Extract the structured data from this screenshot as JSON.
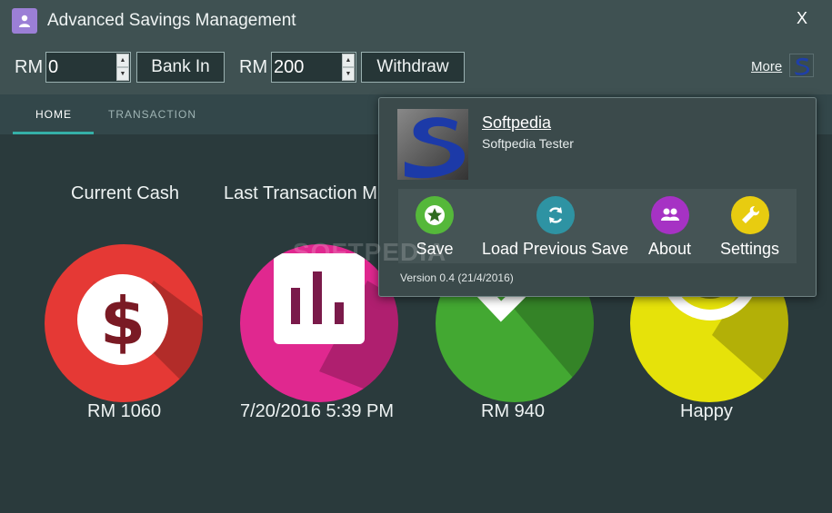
{
  "window": {
    "title": "Advanced Savings Management",
    "close_label": "X"
  },
  "toolbar": {
    "currency_label": "RM",
    "bank_in_amount": "0",
    "bank_in_label": "Bank In",
    "withdraw_amount": "200",
    "withdraw_label": "Withdraw",
    "more_label": "More"
  },
  "tabs": [
    {
      "label": "HOME",
      "active": true
    },
    {
      "label": "TRANSACTION",
      "active": false
    }
  ],
  "cards": [
    {
      "title": "Current Cash",
      "value": "RM 1060",
      "color": "#e53935",
      "icon": "dollar-icon"
    },
    {
      "title": "Last Transaction M",
      "value": "7/20/2016 5:39 PM",
      "color": "#e0288f",
      "icon": "chart-icon"
    },
    {
      "title": "",
      "value": "RM 940",
      "color": "#43a832",
      "icon": "check-icon"
    },
    {
      "title": "",
      "value": "Happy",
      "color": "#e6e20a",
      "icon": "smile-icon"
    }
  ],
  "popup": {
    "user_name": "Softpedia",
    "user_role": "Softpedia Tester",
    "actions": [
      {
        "label": "Save",
        "color": "#55b83a",
        "icon": "star-icon"
      },
      {
        "label": "Load Previous Save",
        "color": "#2e93a3",
        "icon": "refresh-icon"
      },
      {
        "label": "About",
        "color": "#a632c4",
        "icon": "people-icon"
      },
      {
        "label": "Settings",
        "color": "#e8cc10",
        "icon": "wrench-icon"
      }
    ],
    "version": "Version 0.4 (21/4/2016)"
  },
  "watermark": "SOFTPEDIA"
}
